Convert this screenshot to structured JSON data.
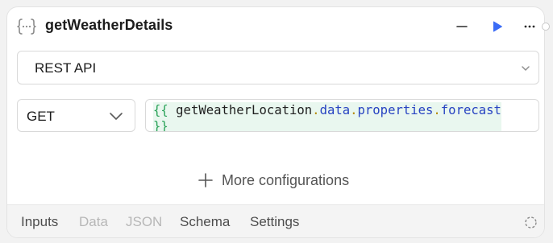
{
  "node": {
    "title": "getWeatherDetails",
    "icon": "function-braces-icon"
  },
  "header_actions": [
    {
      "name": "minimize",
      "icon": "minus-icon"
    },
    {
      "name": "run",
      "icon": "play-icon",
      "color": "#3b6cf6"
    },
    {
      "name": "more",
      "icon": "ellipsis-icon"
    }
  ],
  "integration": {
    "selected": "REST API"
  },
  "request": {
    "method": "GET",
    "url_parts": {
      "open": "{{",
      "source": "getWeatherLocation",
      "dot1": ".",
      "p1": "data",
      "dot2": ".",
      "p2": "properties",
      "dot3": ".",
      "p3": "forecast",
      "close": "}}"
    }
  },
  "more_configurations_label": "More configurations",
  "tabs": [
    {
      "label": "Inputs",
      "state": "active"
    },
    {
      "label": "Data",
      "state": "disabled"
    },
    {
      "label": "JSON",
      "state": "disabled"
    },
    {
      "label": "Schema",
      "state": "active"
    },
    {
      "label": "Settings",
      "state": "active"
    }
  ],
  "colors": {
    "accent": "#3b6cf6",
    "mustache": "#2ca35a",
    "property": "#2743c2"
  }
}
